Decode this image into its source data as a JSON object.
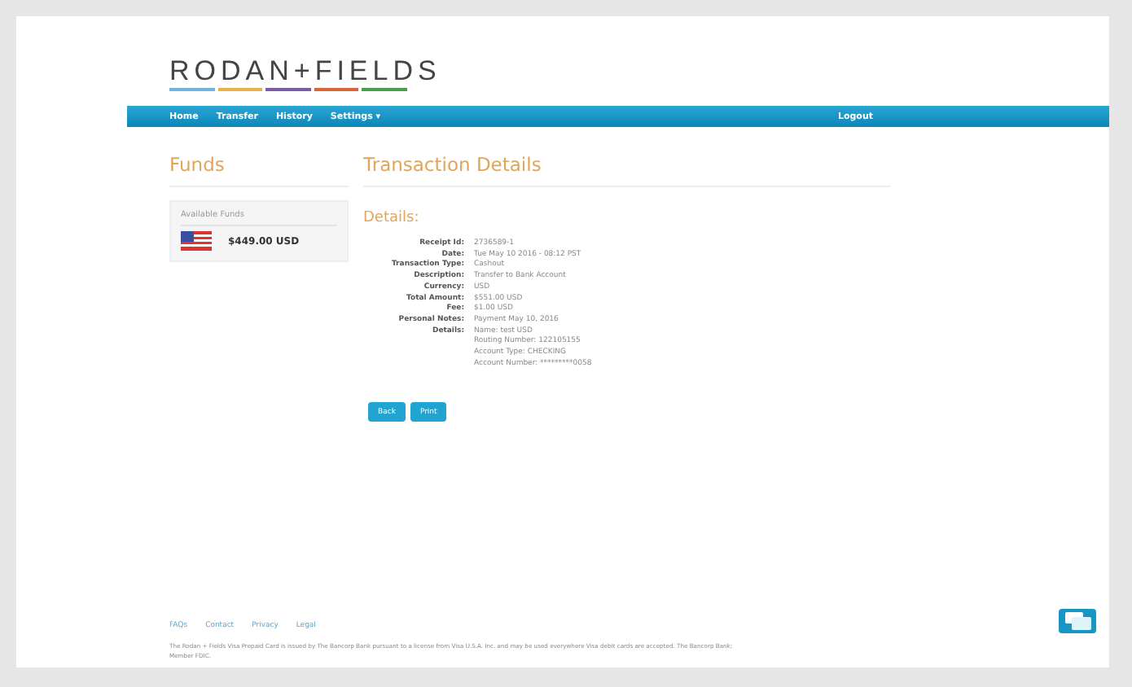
{
  "logo": {
    "text": "RODAN+FIELDS",
    "stripes": [
      {
        "color": "#6fb7d9"
      },
      {
        "color": "#e9b04a"
      },
      {
        "color": "#7a5ba6"
      },
      {
        "color": "#d9643a"
      },
      {
        "color": "#4aa04a"
      }
    ]
  },
  "nav": {
    "items": [
      {
        "label": "Home"
      },
      {
        "label": "Transfer"
      },
      {
        "label": "History"
      },
      {
        "label": "Settings ▾"
      }
    ],
    "logout": "Logout"
  },
  "sidebar": {
    "title": "Funds",
    "card_label": "Available Funds",
    "balance": "$449.00 USD"
  },
  "main": {
    "title": "Transaction Details",
    "subtitle": "Details:",
    "fields": [
      {
        "label": "Receipt Id:",
        "values": [
          "2736589-1"
        ]
      },
      {
        "label": "Date:",
        "values": [
          "Tue May 10 2016 - 08:12 PST"
        ]
      },
      {
        "label": "Transaction Type:",
        "values": [
          "Cashout"
        ]
      },
      {
        "label": "Description:",
        "values": [
          "Transfer to Bank Account"
        ]
      },
      {
        "label": "Currency:",
        "values": [
          "USD"
        ]
      },
      {
        "label": "Total Amount:",
        "values": [
          "$551.00 USD"
        ]
      },
      {
        "label": "Fee:",
        "values": [
          "$1.00 USD"
        ]
      },
      {
        "label": "Personal Notes:",
        "values": [
          "Payment May 10, 2016"
        ]
      },
      {
        "label": "Details:",
        "values": [
          "Name: test USD",
          "Routing Number: 122105155",
          "Account Type: CHECKING",
          "Account Number: *********0058"
        ]
      }
    ],
    "buttons": [
      "Back",
      "Print"
    ]
  },
  "footer": {
    "links": [
      "FAQs",
      "Contact",
      "Privacy",
      "Legal"
    ],
    "disclaimer": "The Rodan + Fields Visa Prepaid Card is issued by The Bancorp Bank pursuant to a license from Visa U.S.A. Inc. and may be used everywhere Visa debit cards are accepted. The Bancorp Bank; Member FDIC."
  }
}
